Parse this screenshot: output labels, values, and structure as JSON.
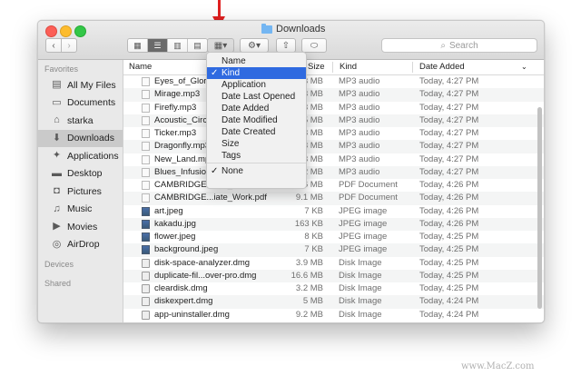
{
  "window": {
    "title": "Downloads"
  },
  "toolbar": {
    "search_placeholder": "Search"
  },
  "sidebar": {
    "favorites_label": "Favorites",
    "items": [
      {
        "label": "All My Files",
        "icon": "all-files-icon"
      },
      {
        "label": "Documents",
        "icon": "documents-icon"
      },
      {
        "label": "starka",
        "icon": "home-icon"
      },
      {
        "label": "Downloads",
        "icon": "downloads-icon",
        "selected": true
      },
      {
        "label": "Applications",
        "icon": "applications-icon"
      },
      {
        "label": "Desktop",
        "icon": "desktop-icon"
      },
      {
        "label": "Pictures",
        "icon": "pictures-icon"
      },
      {
        "label": "Music",
        "icon": "music-icon"
      },
      {
        "label": "Movies",
        "icon": "movies-icon"
      },
      {
        "label": "AirDrop",
        "icon": "airdrop-icon"
      }
    ],
    "devices_label": "Devices",
    "shared_label": "Shared"
  },
  "columns": {
    "name": "Name",
    "size": "Size",
    "kind": "Kind",
    "date": "Date Added"
  },
  "files": [
    {
      "name": "Eyes_of_Glory",
      "size": "3 MB",
      "kind": "MP3 audio",
      "date": "Today, 4:27 PM",
      "type": "doc"
    },
    {
      "name": "Mirage.mp3",
      "size": "3 MB",
      "kind": "MP3 audio",
      "date": "Today, 4:27 PM",
      "type": "doc"
    },
    {
      "name": "Firefly.mp3",
      "size": "3 MB",
      "kind": "MP3 audio",
      "date": "Today, 4:27 PM",
      "type": "doc"
    },
    {
      "name": "Acoustic_Circl",
      "size": "5 MB",
      "kind": "MP3 audio",
      "date": "Today, 4:27 PM",
      "type": "doc"
    },
    {
      "name": "Ticker.mp3",
      "size": "3 MB",
      "kind": "MP3 audio",
      "date": "Today, 4:27 PM",
      "type": "doc"
    },
    {
      "name": "Dragonfly.mp3",
      "size": "3 MB",
      "kind": "MP3 audio",
      "date": "Today, 4:27 PM",
      "type": "doc"
    },
    {
      "name": "New_Land.mp",
      "size": "3 MB",
      "kind": "MP3 audio",
      "date": "Today, 4:27 PM",
      "type": "doc"
    },
    {
      "name": "Blues_Infusion",
      "size": "2 MB",
      "kind": "MP3 audio",
      "date": "Today, 4:27 PM",
      "type": "doc"
    },
    {
      "name": "CAMBRIDGE...iate_Stud.pdf",
      "size": "53.6 MB",
      "kind": "PDF Document",
      "date": "Today, 4:26 PM",
      "type": "doc"
    },
    {
      "name": "CAMBRIDGE...iate_Work.pdf",
      "size": "9.1 MB",
      "kind": "PDF Document",
      "date": "Today, 4:26 PM",
      "type": "doc"
    },
    {
      "name": "art.jpeg",
      "size": "7 KB",
      "kind": "JPEG image",
      "date": "Today, 4:26 PM",
      "type": "img"
    },
    {
      "name": "kakadu.jpg",
      "size": "163 KB",
      "kind": "JPEG image",
      "date": "Today, 4:26 PM",
      "type": "img"
    },
    {
      "name": "flower.jpeg",
      "size": "8 KB",
      "kind": "JPEG image",
      "date": "Today, 4:25 PM",
      "type": "img"
    },
    {
      "name": "background.jpeg",
      "size": "7 KB",
      "kind": "JPEG image",
      "date": "Today, 4:25 PM",
      "type": "img"
    },
    {
      "name": "disk-space-analyzer.dmg",
      "size": "3.9 MB",
      "kind": "Disk Image",
      "date": "Today, 4:25 PM",
      "type": "dmg"
    },
    {
      "name": "duplicate-fil...over-pro.dmg",
      "size": "16.6 MB",
      "kind": "Disk Image",
      "date": "Today, 4:25 PM",
      "type": "dmg"
    },
    {
      "name": "cleardisk.dmg",
      "size": "3.2 MB",
      "kind": "Disk Image",
      "date": "Today, 4:25 PM",
      "type": "dmg"
    },
    {
      "name": "diskexpert.dmg",
      "size": "5 MB",
      "kind": "Disk Image",
      "date": "Today, 4:24 PM",
      "type": "dmg"
    },
    {
      "name": "app-uninstaller.dmg",
      "size": "9.2 MB",
      "kind": "Disk Image",
      "date": "Today, 4:24 PM",
      "type": "dmg"
    }
  ],
  "arrange_menu": {
    "items": [
      {
        "label": "Name",
        "checked": false
      },
      {
        "label": "Kind",
        "checked": true,
        "highlighted": true
      },
      {
        "label": "Application",
        "checked": false
      },
      {
        "label": "Date Last Opened",
        "checked": false
      },
      {
        "label": "Date Added",
        "checked": false
      },
      {
        "label": "Date Modified",
        "checked": false
      },
      {
        "label": "Date Created",
        "checked": false
      },
      {
        "label": "Size",
        "checked": false
      },
      {
        "label": "Tags",
        "checked": false
      }
    ],
    "none_label": "None",
    "none_checked": true,
    "check_mark": "✓"
  },
  "watermark": "www.MacZ.com",
  "colors": {
    "highlight": "#2f6ae0",
    "annotation": "#e02020",
    "folder": "#74b6f2"
  }
}
